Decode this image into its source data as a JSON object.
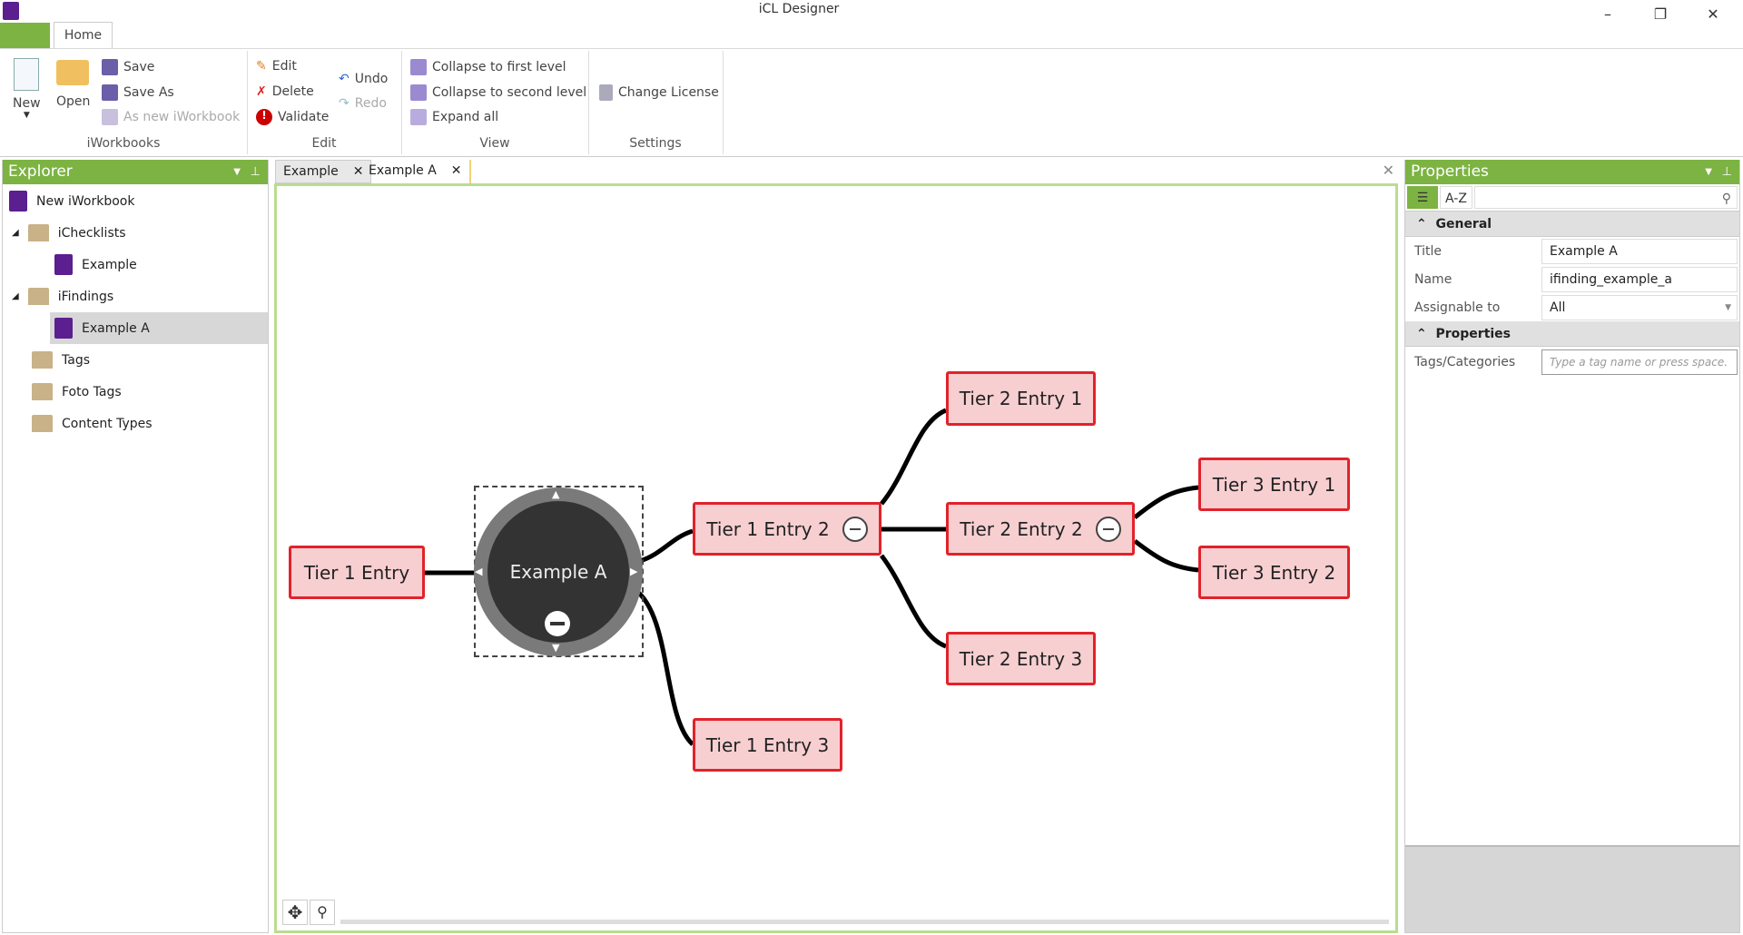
{
  "window": {
    "title": "iCL Designer",
    "controls": [
      "minimize",
      "restore",
      "close"
    ]
  },
  "ribbon": {
    "tabs": [
      {
        "label": "Home"
      }
    ],
    "groups": {
      "iworkbooks": {
        "label": "iWorkbooks",
        "new": "New",
        "open": "Open",
        "save": "Save",
        "save_as": "Save As",
        "as_new": "As new iWorkbook"
      },
      "edit": {
        "label": "Edit",
        "edit": "Edit",
        "delete": "Delete",
        "validate": "Validate",
        "undo": "Undo",
        "redo": "Redo"
      },
      "view": {
        "label": "View",
        "collapse1": "Collapse to first level",
        "collapse2": "Collapse to second level",
        "expand": "Expand all"
      },
      "settings": {
        "label": "Settings",
        "license": "Change License"
      }
    }
  },
  "explorer": {
    "title": "Explorer",
    "items": [
      {
        "label": "New iWorkbook"
      },
      {
        "label": "iChecklists"
      },
      {
        "label": "Example"
      },
      {
        "label": "iFindings"
      },
      {
        "label": "Example A",
        "selected": true
      },
      {
        "label": "Tags"
      },
      {
        "label": "Foto Tags"
      },
      {
        "label": "Content Types"
      }
    ]
  },
  "doc_tabs": [
    {
      "label": "Example"
    },
    {
      "label": "Example A",
      "active": true
    }
  ],
  "mindmap": {
    "root": "Example A",
    "nodes": {
      "t1": "Tier 1 Entry",
      "t1e2": "Tier 1 Entry 2",
      "t1e3": "Tier 1 Entry 3",
      "t2e1": "Tier 2 Entry 1",
      "t2e2": "Tier 2 Entry 2",
      "t2e3": "Tier 2 Entry 3",
      "t3e1": "Tier 3 Entry 1",
      "t3e2": "Tier 3 Entry 2"
    }
  },
  "properties": {
    "title": "Properties",
    "sort_az": "A-Z",
    "general": {
      "label": "General",
      "title_label": "Title",
      "title_value": "Example A",
      "name_label": "Name",
      "name_value": "ifinding_example_a",
      "assign_label": "Assignable to",
      "assign_value": "All"
    },
    "props": {
      "label": "Properties",
      "tags_label": "Tags/Categories",
      "tags_placeholder": "Type a tag name or press space."
    }
  },
  "colors": {
    "accent": "#7cb342",
    "node_fill": "#f8cfd1",
    "node_border": "#e2222b",
    "root": "#333333"
  }
}
